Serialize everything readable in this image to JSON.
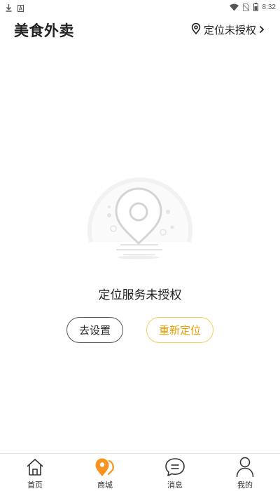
{
  "status_bar": {
    "time": "8:32",
    "left_icons": [
      "download-icon",
      "notification-a-icon"
    ],
    "right_icons": [
      "wifi-icon",
      "no-sim-icon",
      "battery-icon"
    ]
  },
  "header": {
    "title": "美食外卖",
    "location_label": "定位未授权",
    "location_icon": "location-pin-icon",
    "chevron_icon": "chevron-right-icon"
  },
  "empty_state": {
    "illustration": "location-pin-illustration",
    "message": "定位服务未授权",
    "settings_button": "去设置",
    "relocate_button": "重新定位"
  },
  "bottom_nav": {
    "active_color": "#f7931e",
    "items": [
      {
        "label": "首页",
        "icon": "home-icon"
      },
      {
        "label": "商城",
        "icon": "shop-location-icon",
        "active": true
      },
      {
        "label": "消息",
        "icon": "message-icon"
      },
      {
        "label": "我的",
        "icon": "user-icon"
      }
    ]
  }
}
